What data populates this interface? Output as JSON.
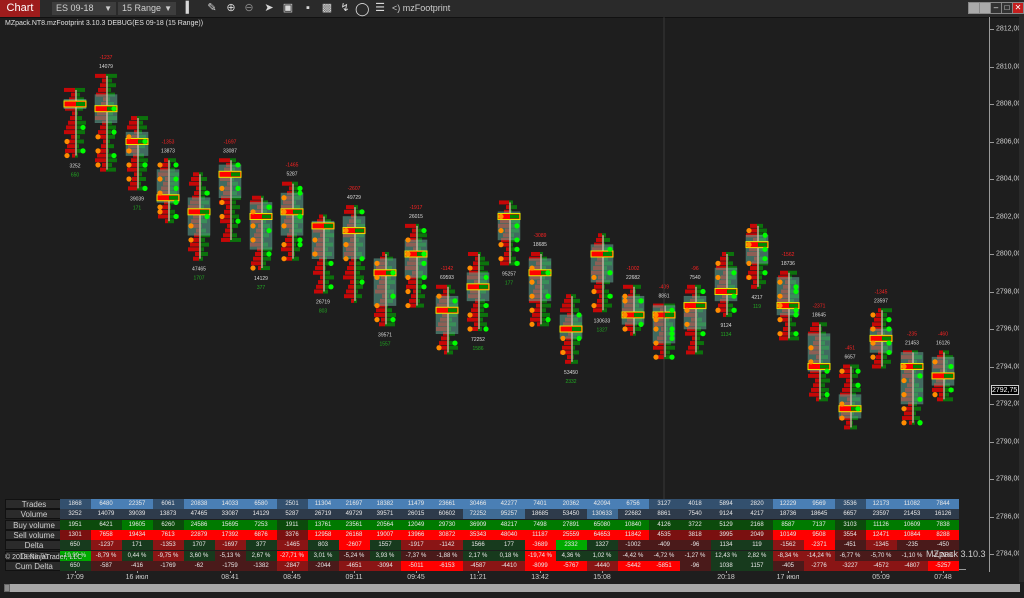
{
  "toolbar": {
    "tab_label": "Chart",
    "instrument": "ES 09-18",
    "interval": "15 Range",
    "indicator_label": "<) mzFootprint",
    "icons": [
      "search-icon",
      "bar-type-icon",
      "pencil-icon",
      "zoom-in-icon",
      "zoom-out-icon",
      "pointer-icon",
      "snapshot-icon",
      "data-box-icon",
      "strategies-icon",
      "drawing-tools-icon",
      "indicator-circle-icon",
      "properties-list-icon"
    ]
  },
  "window_buttons": [
    "blank",
    "blank",
    "minimize",
    "maximize",
    "close"
  ],
  "chart_title": "MZpack.NT8.mzFootprint 3.10.3 DEBUG(ES 09-18 (15 Range))",
  "copyright": "© 2018 NinjaTrader, LLC",
  "watermark": "MZpack 3.10.3",
  "colors": {
    "background": "#1e1e1e",
    "bid_red": "#ff0000",
    "ask_green": "#00aa00",
    "poc_outline": "#e8e800",
    "box_fill": "#5fa896",
    "dot_orange": "#ff8c00",
    "dot_green": "#00ff00",
    "trades_blue": "#4a7fb5",
    "volume_slate": "#2e3b4b"
  },
  "chart_data": {
    "type": "footprint",
    "title": "MZpack.NT8.mzFootprint 3.10.3 DEBUG(ES 09-18 (15 Range))",
    "xlabel": "",
    "ylabel": "Price",
    "ylim": [
      2783.5,
      2812.5
    ],
    "yticks": [
      "2812,00",
      "2810,00",
      "2808,00",
      "2806,00",
      "2804,00",
      "2802,00",
      "2800,00",
      "2798,00",
      "2796,00",
      "2794,00",
      "2792,00",
      "2790,00",
      "2788,00",
      "2786,00",
      "2784,00"
    ],
    "ytick_values": [
      2812,
      2810,
      2808,
      2806,
      2804,
      2802,
      2800,
      2798,
      2796,
      2794,
      2792,
      2790,
      2788,
      2786,
      2784
    ],
    "last_price": "2792,75",
    "last_price_value": 2792.75,
    "xtick_labels": [
      {
        "bar": 0,
        "label": "17:09"
      },
      {
        "bar": 2,
        "label": "16 июл"
      },
      {
        "bar": 5,
        "label": "08:41"
      },
      {
        "bar": 7,
        "label": "08:45"
      },
      {
        "bar": 9,
        "label": "09:11"
      },
      {
        "bar": 11,
        "label": "09:45"
      },
      {
        "bar": 13,
        "label": "11:21"
      },
      {
        "bar": 15,
        "label": "13:42"
      },
      {
        "bar": 17,
        "label": "15:08"
      },
      {
        "bar": 21,
        "label": "20:18"
      },
      {
        "bar": 23,
        "label": "17 июл"
      },
      {
        "bar": 26,
        "label": "05:09"
      },
      {
        "bar": 28,
        "label": "07:48"
      }
    ],
    "bars": [
      {
        "open": 2807.75,
        "close": 2808.25,
        "high": 2808.75,
        "low": 2805.25,
        "poc": 2808.0,
        "vol_label": "3252",
        "delta_label": "650",
        "label_pos": "below"
      },
      {
        "open": 2807.0,
        "close": 2808.5,
        "high": 2809.5,
        "low": 2804.5,
        "poc": 2807.75,
        "vol_label": "14079",
        "delta_label": "-1237",
        "label_pos": "above"
      },
      {
        "open": 2806.5,
        "close": 2805.25,
        "high": 2807.25,
        "low": 2803.5,
        "poc": 2806.0,
        "vol_label": "39039",
        "delta_label": "171",
        "label_pos": "below"
      },
      {
        "open": 2804.5,
        "close": 2802.75,
        "high": 2805.0,
        "low": 2801.75,
        "poc": 2803.0,
        "vol_label": "13873",
        "delta_label": "-1353",
        "label_pos": "above"
      },
      {
        "open": 2803.0,
        "close": 2801.0,
        "high": 2804.25,
        "low": 2799.75,
        "poc": 2802.25,
        "vol_label": "47465",
        "delta_label": "1707",
        "label_pos": "below"
      },
      {
        "open": 2804.75,
        "close": 2803.0,
        "high": 2805.0,
        "low": 2800.75,
        "poc": 2804.25,
        "vol_label": "33087",
        "delta_label": "-1697",
        "label_pos": "above"
      },
      {
        "open": 2802.75,
        "close": 2800.25,
        "high": 2803.0,
        "low": 2799.25,
        "poc": 2802.0,
        "vol_label": "14129",
        "delta_label": "377",
        "label_pos": "below"
      },
      {
        "open": 2803.25,
        "close": 2801.0,
        "high": 2803.75,
        "low": 2799.75,
        "poc": 2802.25,
        "vol_label": "5287",
        "delta_label": "-1465",
        "label_pos": "above"
      },
      {
        "open": 2801.75,
        "close": 2799.75,
        "high": 2802.0,
        "low": 2798.0,
        "poc": 2801.5,
        "vol_label": "26719",
        "delta_label": "803",
        "label_pos": "below"
      },
      {
        "open": 2802.0,
        "close": 2799.75,
        "high": 2802.5,
        "low": 2797.5,
        "poc": 2801.25,
        "vol_label": "49729",
        "delta_label": "-2607",
        "label_pos": "above"
      },
      {
        "open": 2799.75,
        "close": 2797.25,
        "high": 2800.0,
        "low": 2796.25,
        "poc": 2799.0,
        "vol_label": "39571",
        "delta_label": "1557",
        "label_pos": "below"
      },
      {
        "open": 2800.75,
        "close": 2798.75,
        "high": 2801.5,
        "low": 2797.25,
        "poc": 2800.0,
        "vol_label": "26015",
        "delta_label": "-1917",
        "label_pos": "above"
      },
      {
        "open": 2797.75,
        "close": 2795.75,
        "high": 2798.25,
        "low": 2794.75,
        "poc": 2797.0,
        "vol_label": "69593",
        "delta_label": "-1142",
        "label_pos": "above"
      },
      {
        "open": 2799.0,
        "close": 2797.5,
        "high": 2800.0,
        "low": 2796.0,
        "poc": 2798.25,
        "vol_label": "72252",
        "delta_label": "1586",
        "label_pos": "below"
      },
      {
        "open": 2802.25,
        "close": 2800.75,
        "high": 2802.75,
        "low": 2799.5,
        "poc": 2802.0,
        "vol_label": "95257",
        "delta_label": "177",
        "label_pos": "below"
      },
      {
        "open": 2799.75,
        "close": 2797.5,
        "high": 2800.0,
        "low": 2796.25,
        "poc": 2799.0,
        "vol_label": "18685",
        "delta_label": "-3089",
        "label_pos": "above"
      },
      {
        "open": 2796.75,
        "close": 2795.5,
        "high": 2797.75,
        "low": 2794.25,
        "poc": 2796.0,
        "vol_label": "53450",
        "delta_label": "2332",
        "label_pos": "below"
      },
      {
        "open": 2800.5,
        "close": 2798.5,
        "high": 2801.0,
        "low": 2797.0,
        "poc": 2800.0,
        "vol_label": "130633",
        "delta_label": "1327",
        "label_pos": "below"
      },
      {
        "open": 2797.75,
        "close": 2796.25,
        "high": 2798.25,
        "low": 2795.75,
        "poc": 2796.75,
        "vol_label": "22682",
        "delta_label": "-1002",
        "label_pos": "above"
      },
      {
        "open": 2797.25,
        "close": 2795.25,
        "high": 2797.25,
        "low": 2794.5,
        "poc": 2796.75,
        "vol_label": "8861",
        "delta_label": "-409",
        "label_pos": "above"
      },
      {
        "open": 2797.75,
        "close": 2796.0,
        "high": 2798.25,
        "low": 2794.75,
        "poc": 2797.25,
        "vol_label": "7540",
        "delta_label": "-96",
        "label_pos": "above"
      },
      {
        "open": 2799.25,
        "close": 2797.5,
        "high": 2800.0,
        "low": 2796.75,
        "poc": 2798.0,
        "vol_label": "9124",
        "delta_label": "1134",
        "label_pos": "below"
      },
      {
        "open": 2801.0,
        "close": 2799.5,
        "high": 2801.5,
        "low": 2798.25,
        "poc": 2800.5,
        "vol_label": "4217",
        "delta_label": "119",
        "label_pos": "below"
      },
      {
        "open": 2798.75,
        "close": 2796.75,
        "high": 2799.0,
        "low": 2795.5,
        "poc": 2797.25,
        "vol_label": "18736",
        "delta_label": "-1562",
        "label_pos": "above"
      },
      {
        "open": 2795.75,
        "close": 2793.75,
        "high": 2796.25,
        "low": 2792.25,
        "poc": 2794.0,
        "vol_label": "18645",
        "delta_label": "-2371",
        "label_pos": "above"
      },
      {
        "open": 2792.5,
        "close": 2791.25,
        "high": 2794.0,
        "low": 2790.75,
        "poc": 2791.75,
        "vol_label": "6657",
        "delta_label": "-451",
        "label_pos": "above"
      },
      {
        "open": 2796.0,
        "close": 2794.75,
        "high": 2797.0,
        "low": 2794.0,
        "poc": 2795.5,
        "vol_label": "23597",
        "delta_label": "-1345",
        "label_pos": "above"
      },
      {
        "open": 2794.75,
        "close": 2792.0,
        "high": 2794.75,
        "low": 2791.0,
        "poc": 2794.0,
        "vol_label": "21453",
        "delta_label": "-235",
        "label_pos": "above"
      },
      {
        "open": 2794.5,
        "close": 2793.0,
        "high": 2794.75,
        "low": 2792.25,
        "poc": 2793.5,
        "vol_label": "16126",
        "delta_label": "-460",
        "label_pos": "above"
      }
    ],
    "stats_table": {
      "row_labels": [
        "Trades",
        "Volume",
        "Buy volume",
        "Sell volume",
        "Delta",
        "Delta %",
        "Cum Delta"
      ],
      "trades": [
        "1868",
        "6480",
        "22357",
        "6061",
        "20838",
        "14033",
        "6580",
        "2501",
        "11304",
        "21697",
        "18382",
        "11479",
        "23661",
        "30466",
        "42277",
        "7401",
        "20362",
        "42094",
        "6756",
        "3127",
        "4018",
        "5894",
        "2820",
        "12229",
        "9569",
        "3536",
        "12173",
        "11082",
        "7844"
      ],
      "volume": [
        "3252",
        "14079",
        "39039",
        "13873",
        "47465",
        "33087",
        "14129",
        "5287",
        "26719",
        "49729",
        "39571",
        "26015",
        "60602",
        "72252",
        "95257",
        "18685",
        "53450",
        "130633",
        "22682",
        "8861",
        "7540",
        "9124",
        "4217",
        "18736",
        "18645",
        "6657",
        "23597",
        "21453",
        "16126"
      ],
      "buy_volume": [
        "1951",
        "6421",
        "19605",
        "6260",
        "24586",
        "15695",
        "7253",
        "1911",
        "13761",
        "23561",
        "20564",
        "12049",
        "29730",
        "36909",
        "48217",
        "7498",
        "27891",
        "65080",
        "10840",
        "4126",
        "3722",
        "5129",
        "2168",
        "8587",
        "7137",
        "3103",
        "11126",
        "10609",
        "7838"
      ],
      "sell_volume": [
        "1301",
        "7658",
        "19434",
        "7613",
        "22879",
        "17392",
        "6876",
        "3376",
        "12958",
        "26168",
        "19007",
        "13966",
        "30872",
        "35343",
        "48040",
        "11187",
        "25559",
        "64653",
        "11842",
        "4535",
        "3818",
        "3995",
        "2049",
        "10149",
        "9508",
        "3554",
        "12471",
        "10844",
        "8288"
      ],
      "delta": [
        "650",
        "-1237",
        "171",
        "-1353",
        "1707",
        "-1697",
        "377",
        "-1465",
        "803",
        "-2607",
        "1557",
        "-1917",
        "-1142",
        "1566",
        "177",
        "-3689",
        "2332",
        "1327",
        "-1002",
        "-409",
        "-96",
        "1134",
        "119",
        "-1562",
        "-2371",
        "-451",
        "-1345",
        "-235",
        "-450"
      ],
      "delta_pct": [
        "19,99 %",
        "-8,79 %",
        "0,44 %",
        "-9,75 %",
        "3,60 %",
        "-5,13 %",
        "2,67 %",
        "-27,71 %",
        "3,01 %",
        "-5,24 %",
        "3,93 %",
        "-7,37 %",
        "-1,88 %",
        "2,17 %",
        "0,18 %",
        "-19,74 %",
        "4,36 %",
        "1,02 %",
        "-4,42 %",
        "-4,72 %",
        "-1,27 %",
        "12,43 %",
        "2,82 %",
        "-8,34 %",
        "-14,24 %",
        "-6,77 %",
        "-5,70 %",
        "-1,10 %",
        "-2,79 %"
      ],
      "cum_delta": [
        "650",
        "-587",
        "-416",
        "-1769",
        "-62",
        "-1759",
        "-1382",
        "-2847",
        "-2044",
        "-4651",
        "-3094",
        "-5011",
        "-6153",
        "-4587",
        "-4410",
        "-8099",
        "-5767",
        "-4440",
        "-5442",
        "-5851",
        "-96",
        "1038",
        "1157",
        "-405",
        "-2776",
        "-3227",
        "-4572",
        "-4807",
        "-5257"
      ]
    }
  }
}
